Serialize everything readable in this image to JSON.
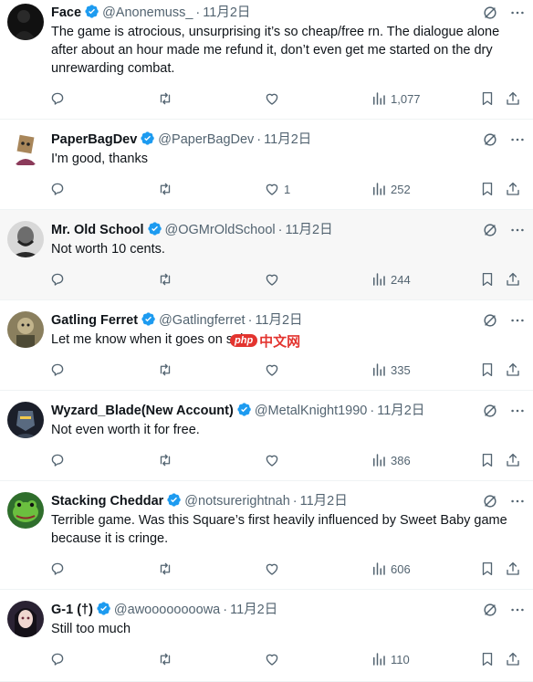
{
  "tweets": [
    {
      "name": "Face",
      "handle": "@Anonemuss_",
      "date": "11月2日",
      "text": "The game is atrocious, unsurprising it’s so cheap/free rn. The dialogue alone after about an hour made me refund it, don’t even get me started on the dry unrewarding combat.",
      "replies": "",
      "reposts": "",
      "likes": "",
      "views": "1,077",
      "avatar": "dark-silhouette"
    },
    {
      "name": "PaperBagDev",
      "handle": "@PaperBagDev",
      "date": "11月2日",
      "text": "I'm good, thanks",
      "replies": "",
      "reposts": "",
      "likes": "1",
      "views": "252",
      "avatar": "paper-bag-character"
    },
    {
      "name": "Mr. Old School",
      "handle": "@OGMrOldSchool",
      "date": "11月2日",
      "text": "Not worth 10 cents.",
      "replies": "",
      "reposts": "",
      "likes": "",
      "views": "244",
      "avatar": "bw-portrait"
    },
    {
      "name": "Gatling Ferret",
      "handle": "@Gatlingferret",
      "date": "11月2日",
      "text": "Let me know when it goes on sale",
      "replies": "",
      "reposts": "",
      "likes": "",
      "views": "335",
      "avatar": "ferret-soldier"
    },
    {
      "name": "Wyzard_Blade(New Account)",
      "handle": "@MetalKnight1990",
      "date": "11月2日",
      "text": "Not even worth it for free.",
      "replies": "",
      "reposts": "",
      "likes": "",
      "views": "386",
      "avatar": "armored-knight"
    },
    {
      "name": "Stacking Cheddar",
      "handle": "@notsurerightnah",
      "date": "11月2日",
      "text": "Terrible game.  Was this Square’s first heavily influenced by Sweet Baby game because it is cringe.",
      "replies": "",
      "reposts": "",
      "likes": "",
      "views": "606",
      "avatar": "green-frog"
    },
    {
      "name": "G-1 (†)",
      "handle": "@awoooooooowa",
      "date": "11月2日",
      "text": "Still too much",
      "replies": "",
      "reposts": "",
      "likes": "",
      "views": "110",
      "avatar": "anime-girl"
    }
  ],
  "watermark": {
    "badge": "php",
    "text": "中文网"
  },
  "colors": {
    "verified": "#1d9bf0",
    "muted": "#536471",
    "highlight_bg": "#f7f7f7"
  }
}
